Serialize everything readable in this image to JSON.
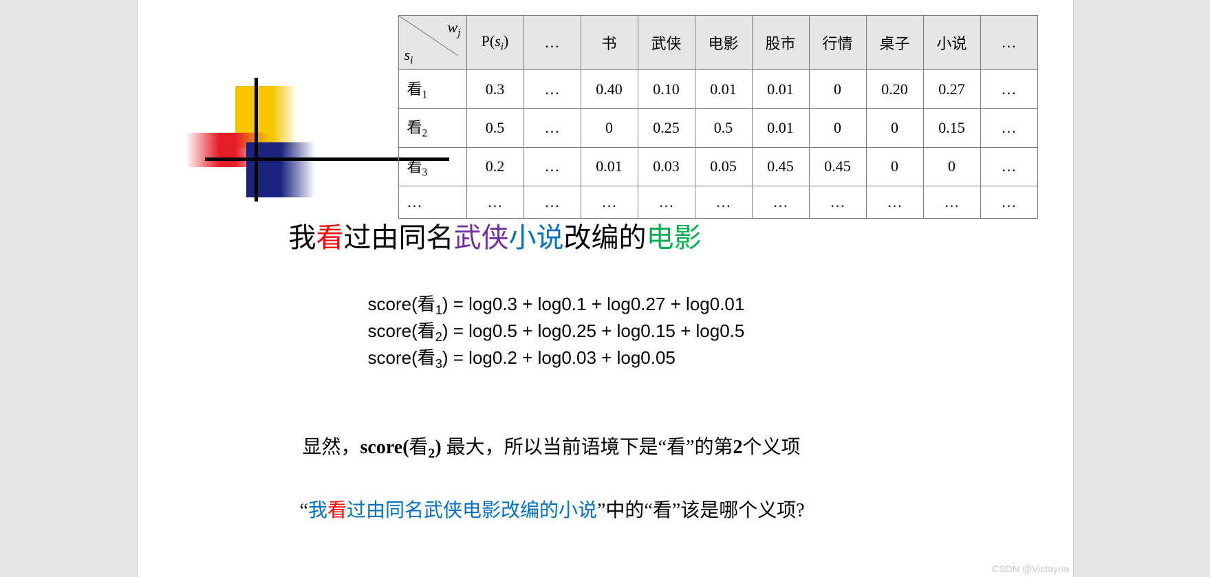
{
  "watermark": "CSDN @Victayria",
  "table": {
    "header": {
      "wj": "w",
      "wj_sub": "j",
      "si": "s",
      "si_sub": "i",
      "psi": "P(",
      "psi_var": "s",
      "psi_sub": "i",
      "psi_close": ")",
      "dots": "…",
      "cols": [
        "书",
        "武侠",
        "电影",
        "股市",
        "行情",
        "桌子",
        "小说",
        "…"
      ]
    },
    "rows": [
      {
        "label": "看",
        "sub": "1",
        "p": "0.3",
        "d": "…",
        "cells": [
          "0.40",
          "0.10",
          "0.01",
          "0.01",
          "0",
          "0.20",
          "0.27",
          "…"
        ]
      },
      {
        "label": "看",
        "sub": "2",
        "p": "0.5",
        "d": "…",
        "cells": [
          "0",
          "0.25",
          "0.5",
          "0.01",
          "0",
          "0",
          "0.15",
          "…"
        ]
      },
      {
        "label": "看",
        "sub": "3",
        "p": "0.2",
        "d": "…",
        "cells": [
          "0.01",
          "0.03",
          "0.05",
          "0.45",
          "0.45",
          "0",
          "0",
          "…"
        ]
      },
      {
        "label": "…",
        "sub": "",
        "p": "…",
        "d": "…",
        "cells": [
          "…",
          "…",
          "…",
          "…",
          "…",
          "…",
          "…",
          "…"
        ]
      }
    ]
  },
  "sentence": {
    "s1": "我",
    "s2": "看",
    "s3": "过由同名",
    "s4": "武侠",
    "s5": "小说",
    "s6": "改编的",
    "s7": "电影"
  },
  "formulas": {
    "f1": {
      "pre": "score(",
      "han": "看",
      "sub": "1",
      "mid": ") = log0.3  + log0.1 + log0.27 + log0.01"
    },
    "f2": {
      "pre": "score(",
      "han": "看",
      "sub": "2",
      "mid": ") = log0.5  + log0.25 + log0.15 + log0.5"
    },
    "f3": {
      "pre": "score(",
      "han": "看",
      "sub": "3",
      "mid": ") = log0.2  + log0.03 + log0.05"
    }
  },
  "conclusion": {
    "pre": "显然，",
    "score": "score(",
    "han": "看",
    "sub": "2",
    "close": ")",
    "mid": " 最大，所以当前语境下是“看”的第",
    "n": "2",
    "post": "个义项"
  },
  "question": {
    "q1": "“",
    "q2": "我",
    "q3": "看",
    "q4": "过由同名武侠电影改编的小说",
    "q5": "”中的“看”该是哪个义项?"
  }
}
